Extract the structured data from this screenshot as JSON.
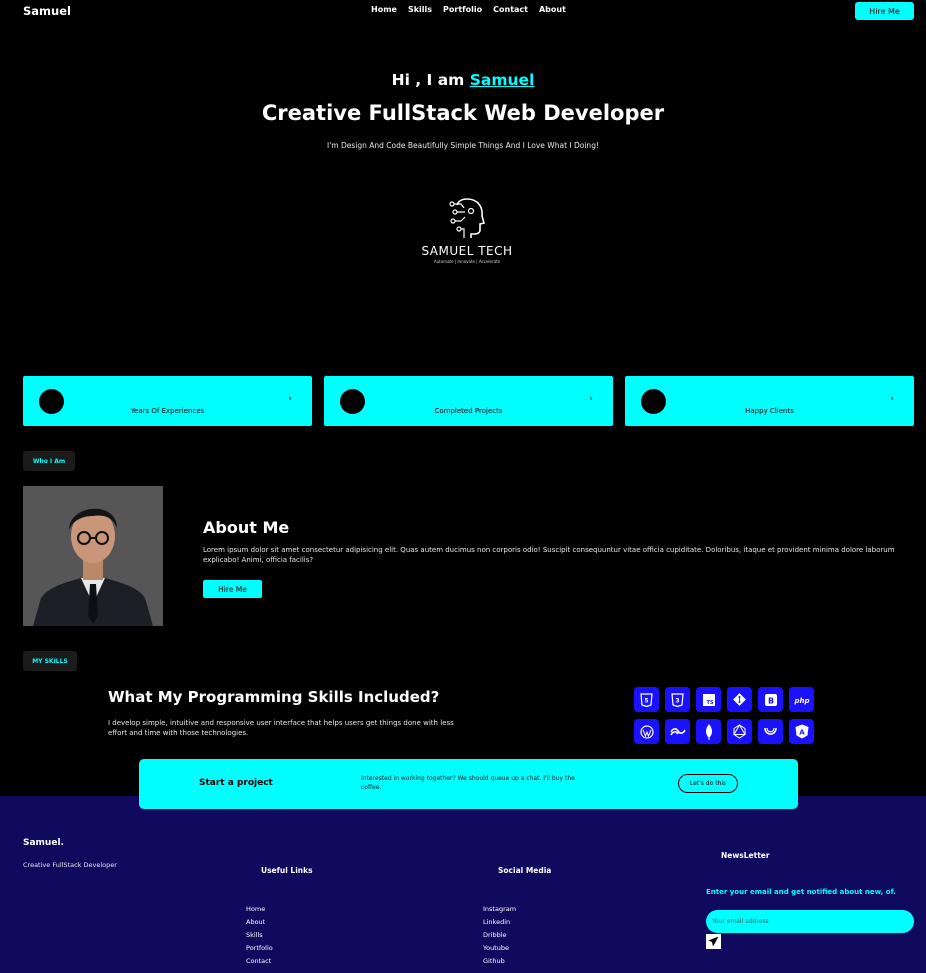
{
  "nav": {
    "brand": "Samuel",
    "links": [
      "Home",
      "Skills",
      "Portfolio",
      "Contact",
      "About"
    ],
    "hire_label": "Hire Me"
  },
  "hero": {
    "greeting": "Hi , I am",
    "name": "Samuel",
    "title": "Creative FullStack Web Developer",
    "subtitle": "I'm Design And Code Beautifully Simple Things And I Love What I Doing!",
    "logo_name": "SAMUEL TECH",
    "logo_tagline": "Automate | Innovate | Accelerate"
  },
  "stats": [
    {
      "label": "Years Of Experiences",
      "icon": "chevron-right-icon"
    },
    {
      "label": "Completed Projects",
      "icon": "chevron-right-icon"
    },
    {
      "label": "Happy Clients",
      "icon": "chevron-right-icon"
    }
  ],
  "about": {
    "pill": "Who I Am",
    "title": "About Me",
    "text": "Lorem ipsum dolor sit amet consectetur adipisicing elit. Quas autem ducimus non corporis odio! Suscipit consequuntur vitae officia cupiditate. Doloribus, itaque et provident minima dolore laborum explicabo! Animi, officia facilis?",
    "hire_label": "Hire Me"
  },
  "skills": {
    "pill": "MY SKILLS",
    "title": "What My Programming Skills Included?",
    "text": "I develop simple, intuitive and responsive user interface that helps users get things done with less effort and time with those technologies.",
    "icons": [
      "html5-icon",
      "css3-icon",
      "typescript-icon",
      "git-icon",
      "bootstrap-icon",
      "php-icon",
      "wordpress-icon",
      "tailwind-icon",
      "mongodb-icon",
      "graphql-icon",
      "laravel-icon",
      "angular-icon"
    ]
  },
  "project": {
    "title": "Start a project",
    "text": "Interested in working together? We should queue up a chat. I'll buy the coffee.",
    "button": "Let's do this"
  },
  "footer": {
    "brand": "Samuel.",
    "tagline": "Creative FullStack Developer",
    "useful_title": "Useful Links",
    "useful_links": [
      "Home",
      "About",
      "Skills",
      "Portfolio",
      "Contact"
    ],
    "social_title": "Social Media",
    "social_links": [
      "Instagram",
      "Linkedin",
      "Dribble",
      "Youtube",
      "Github"
    ],
    "newsletter_title": "NewsLetter",
    "newsletter_text": "Enter your email and get notified about new, of.",
    "email_placeholder": "Your email address"
  },
  "colors": {
    "accent": "#00ffff",
    "footer_bg": "#100a5e",
    "skill_bg": "#1a12ff"
  }
}
